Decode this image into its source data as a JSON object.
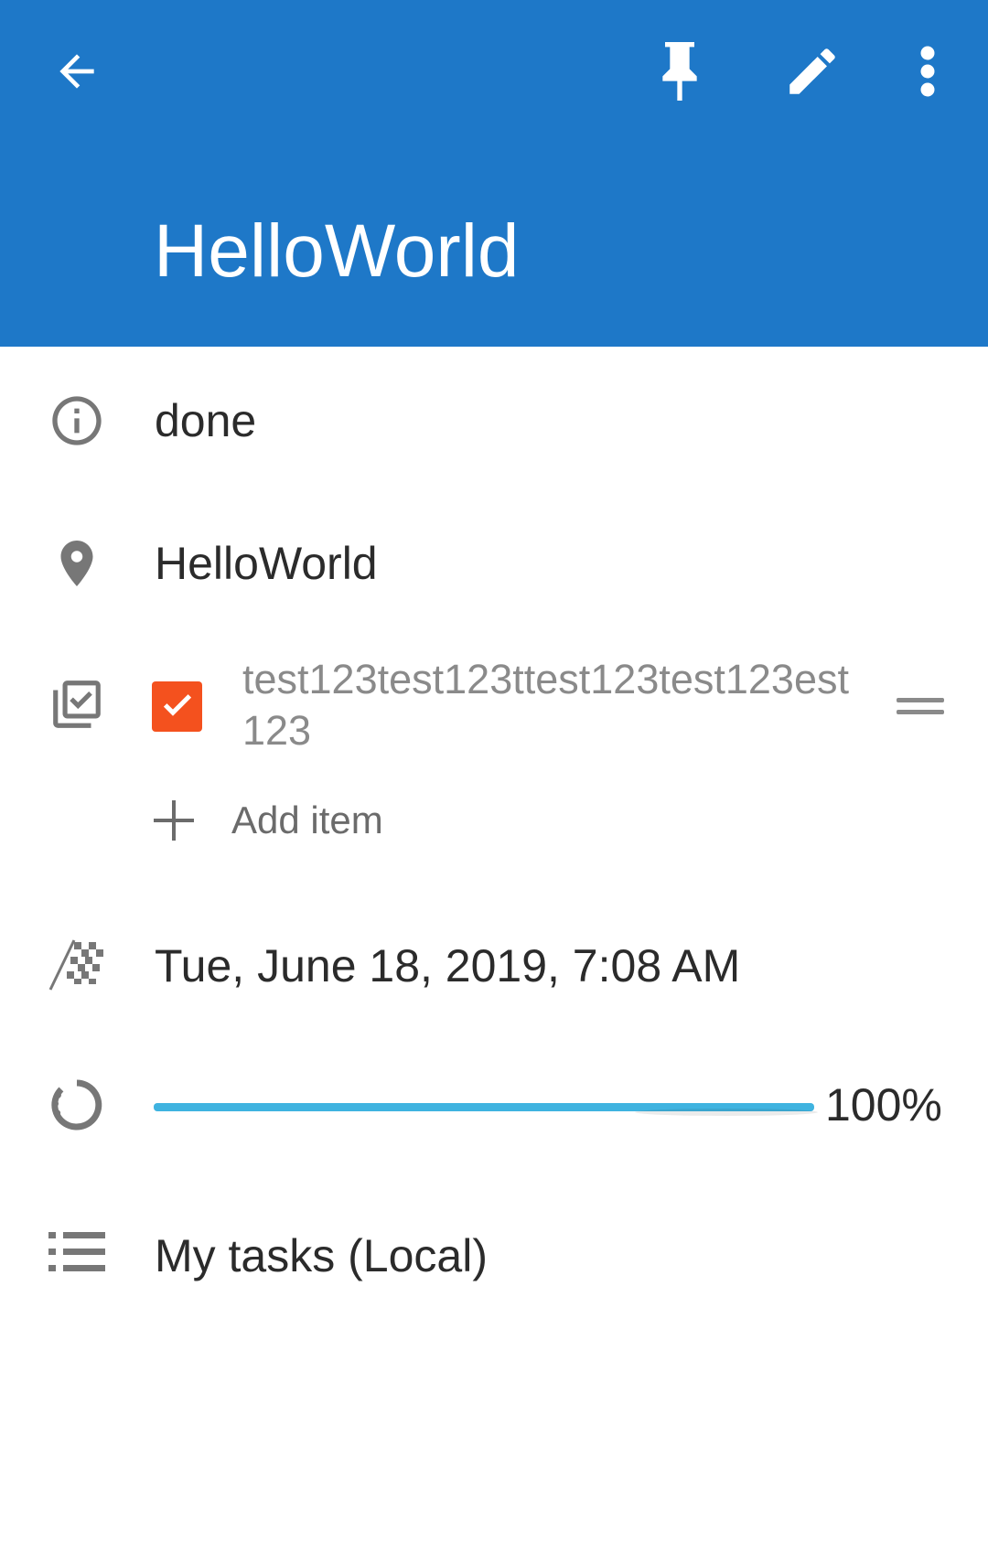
{
  "appbar": {
    "title": "HelloWorld",
    "background": "#1e78c8",
    "actions": [
      "back-arrow-icon",
      "pin-icon",
      "edit-pencil-icon",
      "more-vert-icon"
    ]
  },
  "task": {
    "status": "done",
    "location": "HelloWorld",
    "checklist": {
      "items": [
        {
          "text": "test123test123ttest123test123est123",
          "checked": true
        }
      ],
      "add_item_label": "Add item",
      "checkbox_color": "#f4511e"
    },
    "due": "Tue, June 18, 2019, 7:08 AM",
    "progress": {
      "percent": 100,
      "label": "100%",
      "color": "#3fb3e0"
    },
    "list": "My tasks (Local)"
  }
}
